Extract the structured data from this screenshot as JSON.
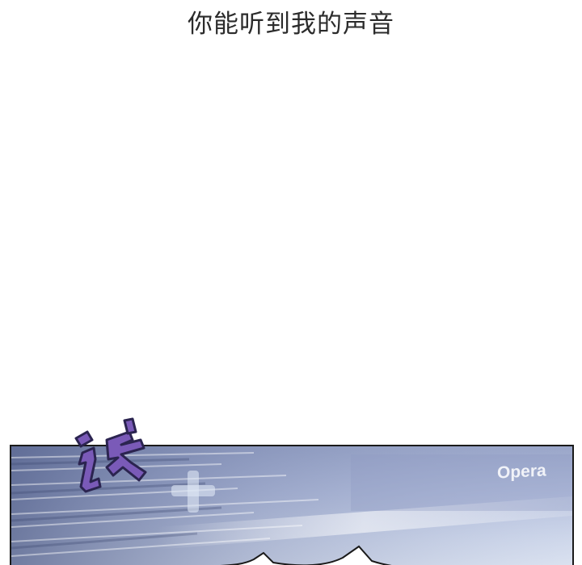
{
  "caption": {
    "text": "你能听到我的声音"
  },
  "panel": {
    "screen_text": "Opera",
    "sfx_icon": "dizzy-sfx-glyph-icon",
    "colors": {
      "sky": "#b3bedc",
      "sfx_fill": "#7a5ab8",
      "sfx_outline": "#2b2450",
      "border": "#1a1a1a"
    }
  }
}
